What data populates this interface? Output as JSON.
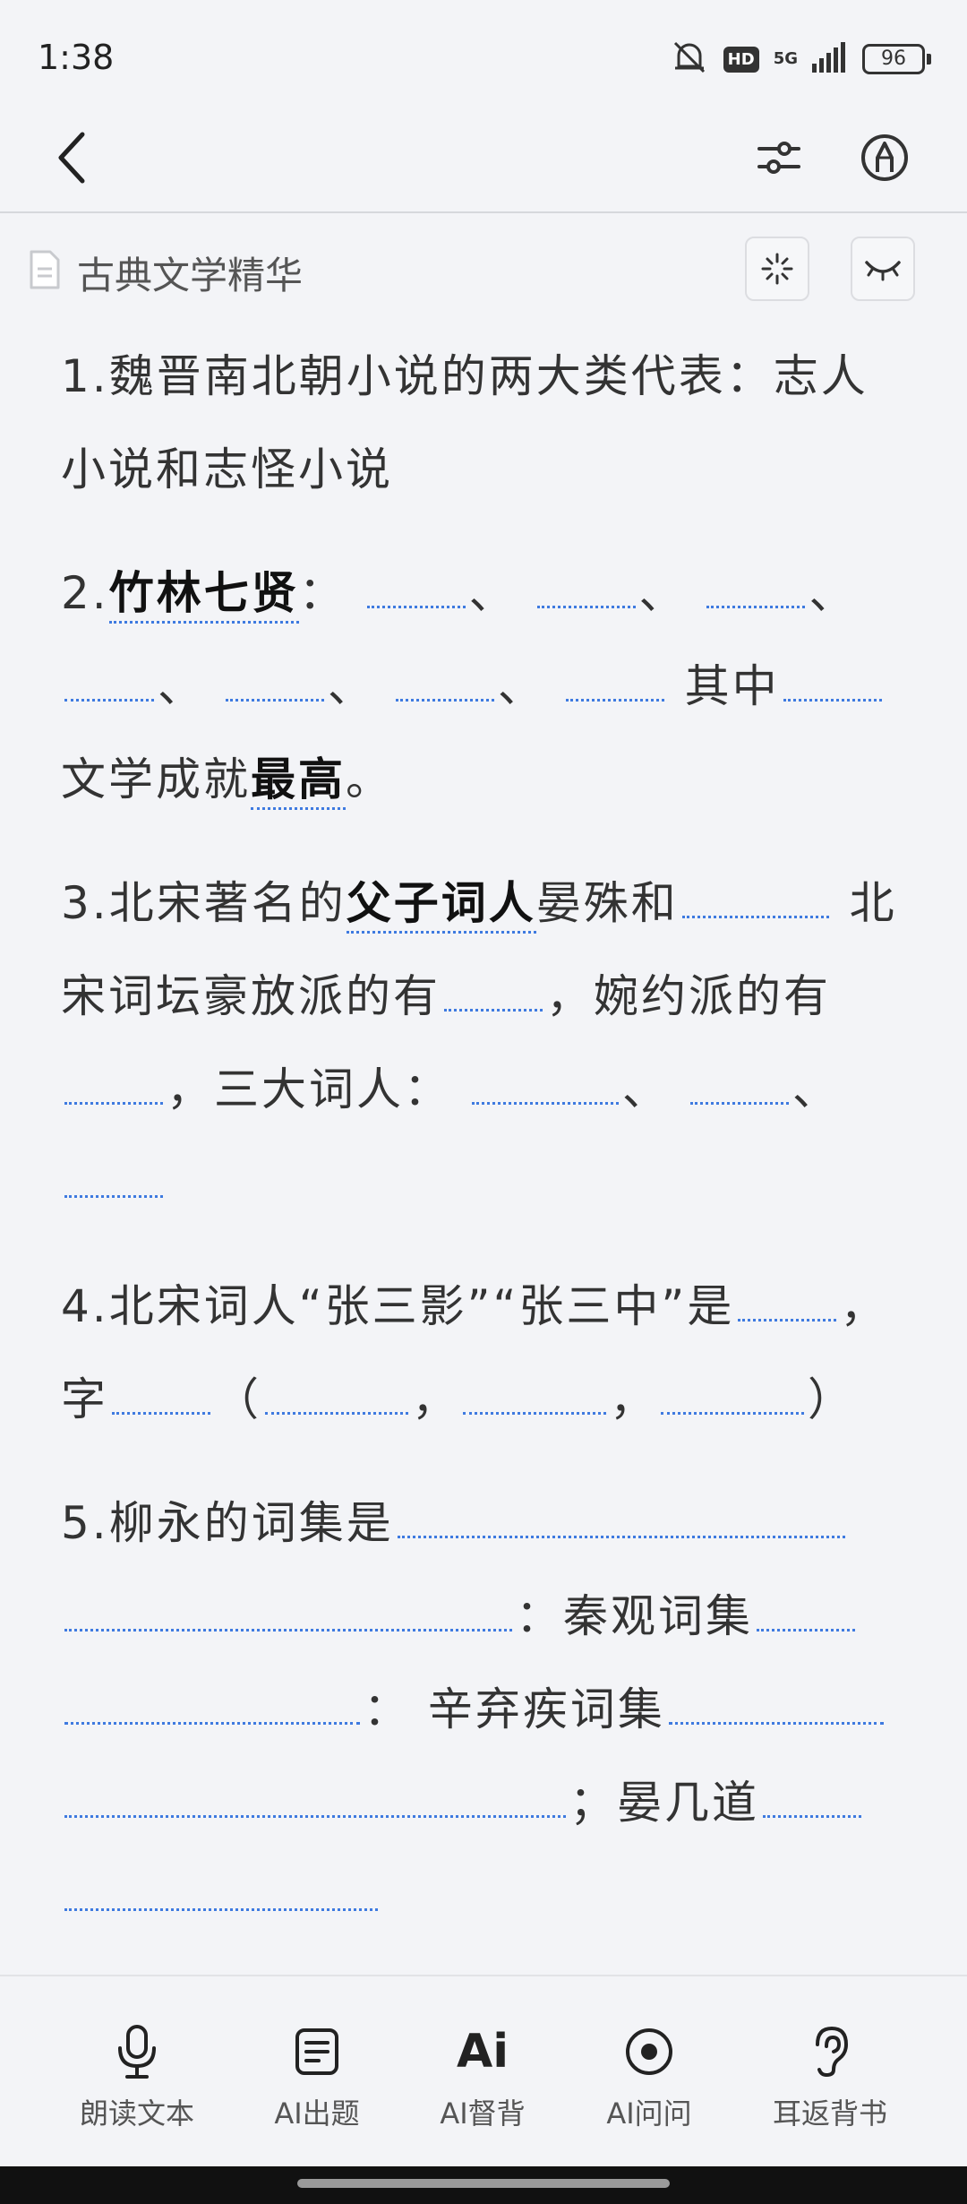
{
  "status": {
    "time": "1:38",
    "hd": "HD",
    "network": "5G",
    "battery": "96"
  },
  "doc": {
    "title": "古典文学精华"
  },
  "questions": {
    "q1": "1.魏晋南北朝小说的两大类代表：志人小说和志怪小说",
    "q2": {
      "prefix": "2.",
      "bold1": "竹林七贤",
      "p1": "：",
      "sep": "、",
      "p2": " 其中",
      "p3": "文学成就",
      "bold2": "最高",
      "p4": "。"
    },
    "q3": {
      "p1": "3.北宋著名的",
      "bold1": "父子词人",
      "p2": "晏殊和",
      "p3": " 北宋词坛豪放派的有",
      "p4": "，婉约派的有",
      "p5": "，三大词人：",
      "sep": "、"
    },
    "q4": {
      "p1": "4.北宋词人“张三影”“张三中”是",
      "p2": "，字",
      "p3": "（",
      "comma": "，",
      "p4": "）"
    },
    "q5": {
      "p1": "5.柳永的词集是",
      "p2": "：秦观词集",
      "p3": "：  辛弃疾词集",
      "p4": "；晏几道"
    }
  },
  "toolbar": {
    "read_label": "朗读文本",
    "quiz_label": "AI出题",
    "recite_label": "AI督背",
    "ask_label": "AI问问",
    "earback_label": "耳返背书",
    "ai_glyph": "Ai"
  }
}
